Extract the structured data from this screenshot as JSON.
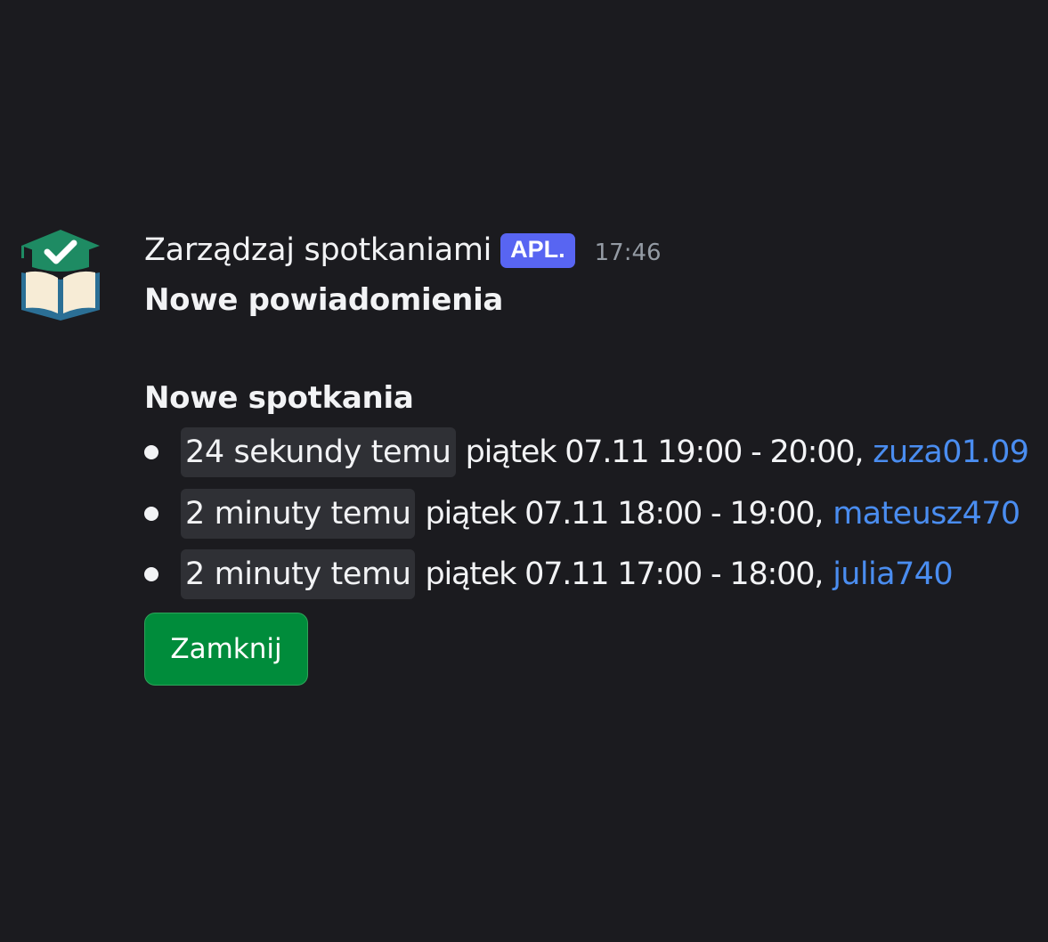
{
  "message": {
    "author": "Zarządzaj spotkaniami",
    "badge": "APL.",
    "timestamp": "17:46",
    "title": "Nowe powiadomienia",
    "section_title": "Nowe spotkania",
    "meetings": [
      {
        "ago": "24 sekundy temu",
        "when": "piątek 07.11 19:00 - 20:00,",
        "user": "zuza01.09"
      },
      {
        "ago": "2 minuty temu",
        "when": "piątek 07.11 18:00 - 19:00,",
        "user": "mateusz470"
      },
      {
        "ago": "2 minuty temu",
        "when": "piątek 07.11 17:00 - 18:00,",
        "user": "julia740"
      }
    ],
    "close_label": "Zamknij"
  },
  "colors": {
    "background": "#1b1b1f",
    "badge": "#5865f2",
    "link": "#4a8df0",
    "button": "#008c3b",
    "avatar_green": "#1e8b63",
    "avatar_blue": "#2b6f95"
  },
  "icons": {
    "avatar": "graduation-cap-book-check-icon"
  }
}
